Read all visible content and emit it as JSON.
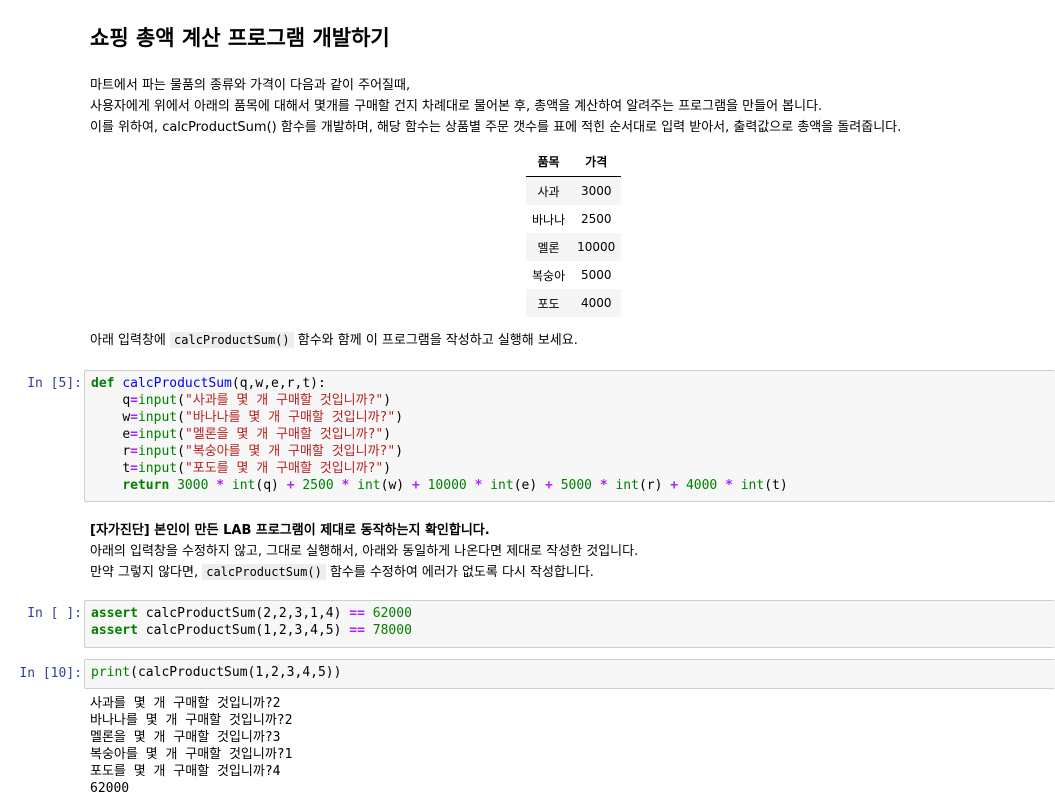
{
  "title": "쇼핑 총액 계산 프로그램 개발하기",
  "intro": [
    "마트에서 파는 물품의 종류와 가격이 다음과 같이 주어질때,",
    "사용자에게 위에서 아래의 품목에 대해서 몇개를 구매할 건지 차례대로 물어본 후, 총액을 계산하여 알려주는 프로그램을 만들어 봅니다.",
    "이를 위하여, calcProductSum() 함수를 개발하며, 해당 함수는 상품별 주문 갯수를 표에 적힌 순서대로 입력 받아서, 출력값으로 총액을 돌려줍니다."
  ],
  "table": {
    "headers": [
      "품목",
      "가격"
    ],
    "rows": [
      [
        "사과",
        "3000"
      ],
      [
        "바나나",
        "2500"
      ],
      [
        "멜론",
        "10000"
      ],
      [
        "복숭아",
        "5000"
      ],
      [
        "포도",
        "4000"
      ]
    ]
  },
  "instruction": {
    "before": "아래 입력창에 ",
    "code": "calcProductSum()",
    "after": " 함수와 함께 이 프로그램을 작성하고 실행해 보세요."
  },
  "cells": {
    "c1": {
      "prompt": "In [5]:"
    },
    "c2": {
      "prompt": "In [ ]:"
    },
    "c3": {
      "prompt": "In [10]:"
    }
  },
  "code1": {
    "def_kw": "def",
    "fn_name": "calcProductSum",
    "params": "(q,w,e,r,t):",
    "lines": [
      {
        "var": "q",
        "arg": "\"사과를 몇 개 구매할 것입니까?\""
      },
      {
        "var": "w",
        "arg": "\"바나나를 몇 개 구매할 것입니까?\""
      },
      {
        "var": "e",
        "arg": "\"멜론을 몇 개 구매할 것입니까?\""
      },
      {
        "var": "r",
        "arg": "\"복숭아를 몇 개 구매할 것입니까?\""
      },
      {
        "var": "t",
        "arg": "\"포도를 몇 개 구매할 것입니까?\""
      }
    ],
    "input_fn": "input",
    "return_kw": "return",
    "prices": [
      "3000",
      "2500",
      "10000",
      "5000",
      "4000"
    ],
    "int_fn": "int",
    "vars": [
      "q",
      "w",
      "e",
      "r",
      "t"
    ]
  },
  "selfcheck": {
    "bold": "[자가진단] 본인이 만든 LAB 프로그램이 제대로 동작하는지 확인합니다.",
    "line2": "아래의 입력창을 수정하지 않고, 그대로 실행해서, 아래와 동일하게 나온다면 제대로 작성한 것입니다.",
    "line3_before": "만약 그렇지 않다면, ",
    "line3_code": "calcProductSum()",
    "line3_after": " 함수를 수정하여 에러가 없도록 다시 작성합니다."
  },
  "code2": [
    {
      "kw": "assert",
      "call": " calcProductSum(2,2,3,1,4) ",
      "op": "==",
      "num": " 62000"
    },
    {
      "kw": "assert",
      "call": " calcProductSum(1,2,3,4,5) ",
      "op": "==",
      "num": " 78000"
    }
  ],
  "code3": {
    "fn": "print",
    "rest": "(calcProductSum(1,2,3,4,5))"
  },
  "output": [
    "사과를 몇 개 구매할 것입니까?2",
    "바나나를 몇 개 구매할 것입니까?2",
    "멜론을 몇 개 구매할 것입니까?3",
    "복숭아를 몇 개 구매할 것입니까?1",
    "포도를 몇 개 구매할 것입니까?4",
    "62000"
  ]
}
